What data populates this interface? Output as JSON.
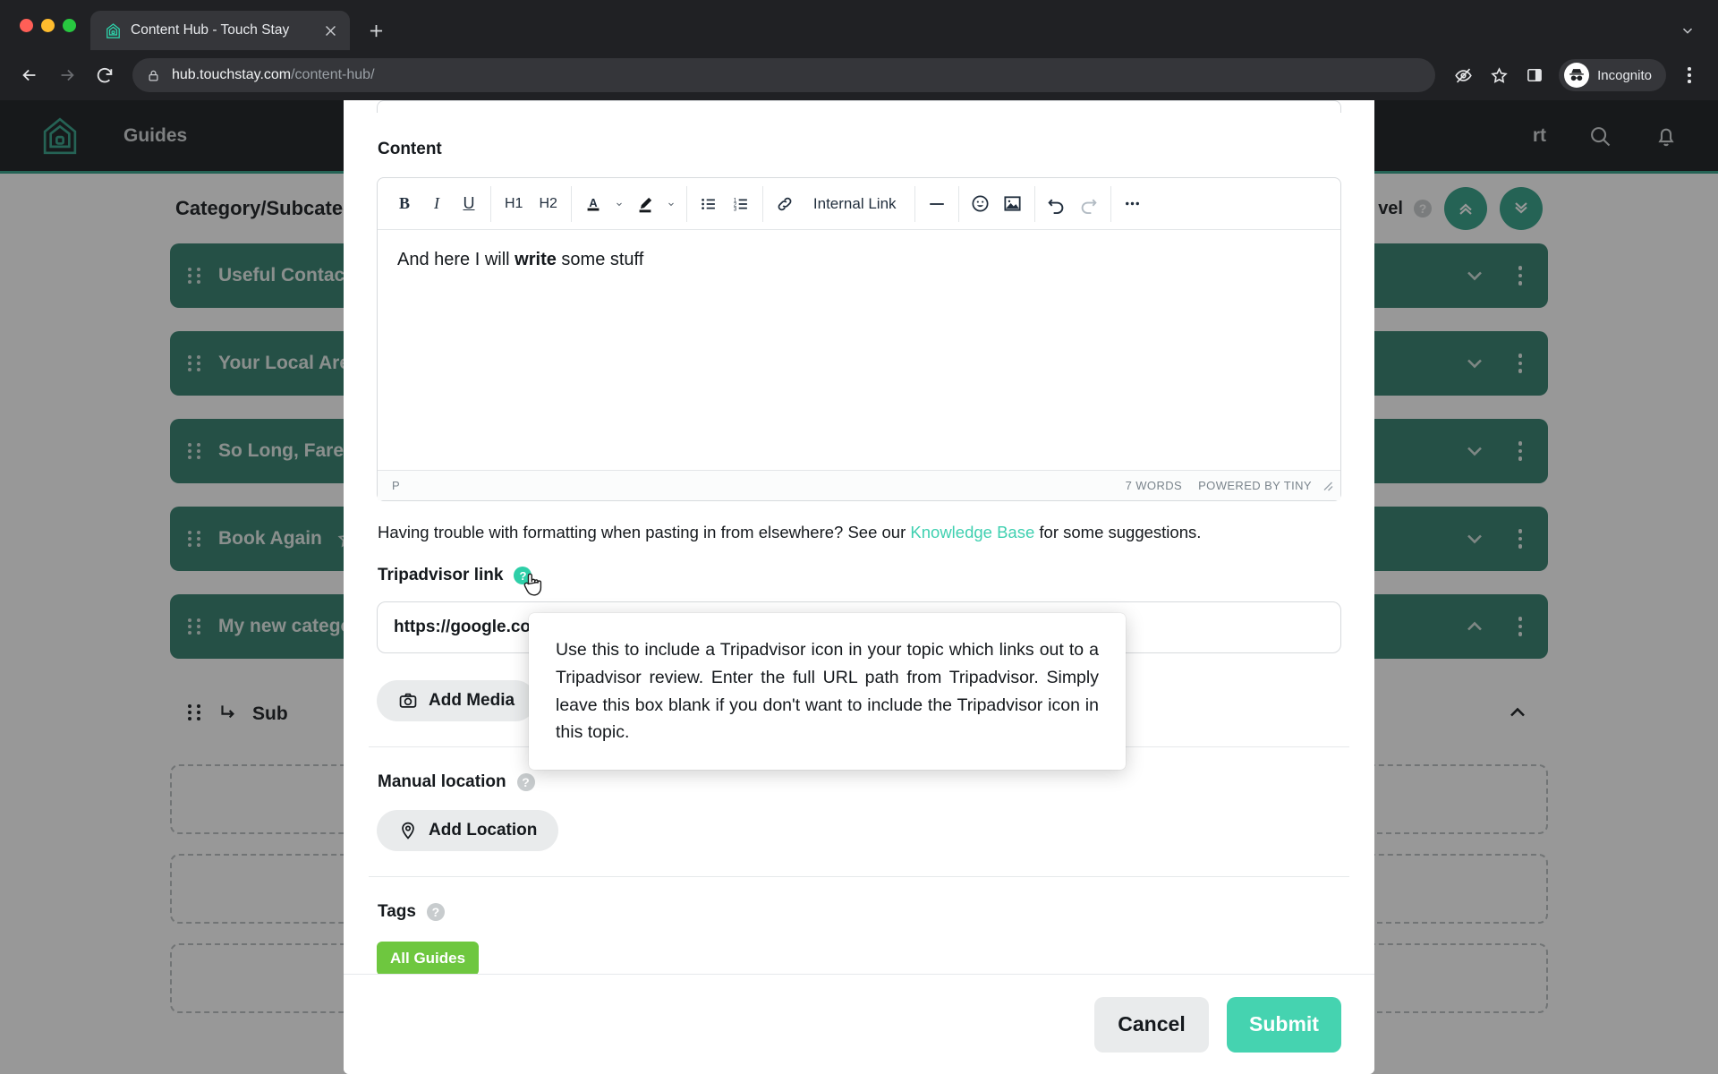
{
  "browser": {
    "tab": {
      "title": "Content Hub - Touch Stay",
      "favicon_icon": "house-logo-icon",
      "close_icon": "close-icon"
    },
    "new_tab_icon": "plus-icon",
    "tab_list_icon": "chevron-down-icon",
    "nav": {
      "back_icon": "back-arrow-icon",
      "forward_icon": "forward-arrow-icon",
      "reload_icon": "reload-icon"
    },
    "omnibox": {
      "lock_icon": "lock-icon",
      "url_host": "hub.touchstay.com",
      "url_path": "/content-hub/",
      "tracking_protection_icon": "eye-slash-icon",
      "bookmark_icon": "star-outline-icon",
      "side_panel_icon": "side-panel-icon"
    },
    "profile": {
      "label": "Incognito",
      "avatar_icon": "incognito-avatar-icon"
    },
    "menu_icon": "kebab-menu-icon"
  },
  "app": {
    "topnav": {
      "logo_icon": "touchstay-house-logo-icon",
      "links": [
        "Guides"
      ],
      "truncated_link": "rt",
      "search_icon": "search-icon",
      "notifications_icon": "bell-icon"
    },
    "content_header": {
      "title": "Category/Subcateg",
      "level_label": "vel",
      "level_help_icon": "help-circle-icon",
      "collapse_all_icon": "double-chevron-up-icon",
      "expand_all_icon": "double-chevron-down-icon"
    },
    "rows": [
      {
        "label": "Useful Contact",
        "starred": false,
        "chevron": "down",
        "grip_icon": "drag-grip-icon",
        "kebab_icon": "kebab-menu-icon"
      },
      {
        "label": "Your Local Area",
        "starred": false,
        "chevron": "down",
        "grip_icon": "drag-grip-icon",
        "kebab_icon": "kebab-menu-icon"
      },
      {
        "label": "So Long, Farew",
        "starred": false,
        "chevron": "down",
        "grip_icon": "drag-grip-icon",
        "kebab_icon": "kebab-menu-icon"
      },
      {
        "label": "Book Again",
        "starred": true,
        "chevron": "down",
        "grip_icon": "drag-grip-icon",
        "kebab_icon": "kebab-menu-icon"
      },
      {
        "label": "My new catego",
        "starred": false,
        "chevron": "up",
        "grip_icon": "drag-grip-icon",
        "kebab_icon": "kebab-menu-icon"
      }
    ],
    "sub_row": {
      "label": "Sub",
      "grip_icon": "drag-grip-icon",
      "arrow_icon": "subcategory-arrow-icon",
      "chevron": "up",
      "kebab_icon": "kebab-menu-icon"
    }
  },
  "modal": {
    "content_label": "Content",
    "editor": {
      "toolbar": {
        "bold": "B",
        "italic": "I",
        "underline": "U",
        "h1": "H1",
        "h2": "H2",
        "text_color_icon": "text-color-icon",
        "text_color_chevron_icon": "chevron-down-icon",
        "highlight_icon": "highlight-pen-icon",
        "highlight_chevron_icon": "chevron-down-icon",
        "bullet_list_icon": "bullet-list-icon",
        "numbered_list_icon": "numbered-list-icon",
        "link_icon": "link-icon",
        "internal_link_label": "Internal Link",
        "horizontal_rule_icon": "horizontal-rule-icon",
        "emoji_icon": "emoji-icon",
        "image_icon": "image-icon",
        "undo_icon": "undo-icon",
        "redo_icon": "redo-icon",
        "more_icon": "more-ellipsis-icon"
      },
      "body_text_before": "And here I will ",
      "body_text_bold": "write",
      "body_text_after": " some stuff",
      "status_element": "P",
      "status_words": "7 WORDS",
      "status_brand": "POWERED BY TINY",
      "resize_icon": "resize-grip-icon"
    },
    "format_help": {
      "before": "Having trouble with formatting when pasting in from elsewhere? See our ",
      "link": "Knowledge Base",
      "after": " for some suggestions."
    },
    "tripadvisor": {
      "label": "Tripadvisor link",
      "help_icon": "help-circle-icon",
      "value": "https://google.com",
      "cursor_icon": "pointer-hand-cursor-icon"
    },
    "tooltip": {
      "text": "Use this to include a Tripadvisor icon in your topic which links out to a Tripadvisor review. Enter the full URL path from Tripadvisor. Simply leave this box blank if you don't want to include the Tripadvisor icon in this topic."
    },
    "add_media": {
      "label": "Add Media",
      "icon": "camera-icon"
    },
    "manual_location": {
      "label": "Manual location",
      "help_icon": "help-circle-icon",
      "button_label": "Add Location",
      "button_icon": "map-pin-icon"
    },
    "tags": {
      "label": "Tags",
      "help_icon": "help-circle-icon",
      "chips": [
        "All Guides"
      ]
    },
    "footer": {
      "cancel_label": "Cancel",
      "submit_label": "Submit"
    }
  },
  "colors": {
    "brand_teal": "#2e9e85",
    "accent_mint": "#45d3b0",
    "help_teal": "#2ecfa8",
    "row_green": "#2e7d6b",
    "tag_green": "#6ec73f",
    "link_mint": "#3fd0b0",
    "chrome_dark": "#202124",
    "nav_dark": "#15191d"
  }
}
